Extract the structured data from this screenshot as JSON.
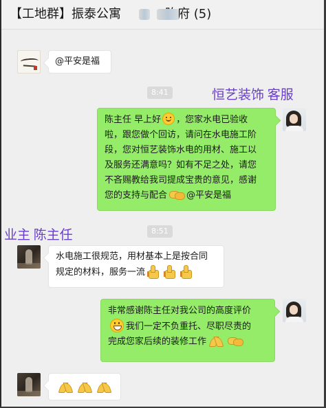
{
  "window": {
    "title": "【工地群】振泰公寓",
    "title_tail": "陈府 (5)"
  },
  "messages": [
    {
      "sender": "other",
      "avatar": "calligraphy-avatar",
      "text": "@平安是福"
    },
    {
      "time": "8:41"
    },
    {
      "sender": "self",
      "avatar": "girl-avatar",
      "lines": [
        "陈主任 早上好",
        "，您家水电已验收",
        "啦，跟您做个回访，请问在水电施工阶",
        "段，您对恒艺装饰水电的用材、施工以",
        "及服务还满意吗？如有不足之处，请您",
        "不吝赐教给我司提成宝贵的意见，感谢",
        "您的支持与配合",
        "@平安是福"
      ]
    },
    {
      "time": "8:51"
    },
    {
      "sender": "other",
      "avatar": "site-photo-avatar",
      "lines": [
        "水电施工很规范，用材基本上是按合同",
        "规定的材料，服务一流"
      ]
    },
    {
      "sender": "self",
      "avatar": "girl-avatar",
      "lines": [
        "非常感谢陈主任对我公司的高度评价",
        "我们一定不负重托、尽职尽责的",
        "完成您家后续的装修工作"
      ]
    },
    {
      "sender": "other",
      "avatar": "site-photo-avatar",
      "emoji_only": [
        "pray-hands",
        "pray-hands",
        "pray-hands"
      ]
    }
  ],
  "annotations": {
    "company_label": "恒艺装饰  客服",
    "owner_label": "业主  陈主任"
  },
  "colors": {
    "chat_background": "#efefef",
    "self_bubble": "#95ec69",
    "other_bubble": "#ffffff",
    "annotation": "#6a3fc9"
  }
}
